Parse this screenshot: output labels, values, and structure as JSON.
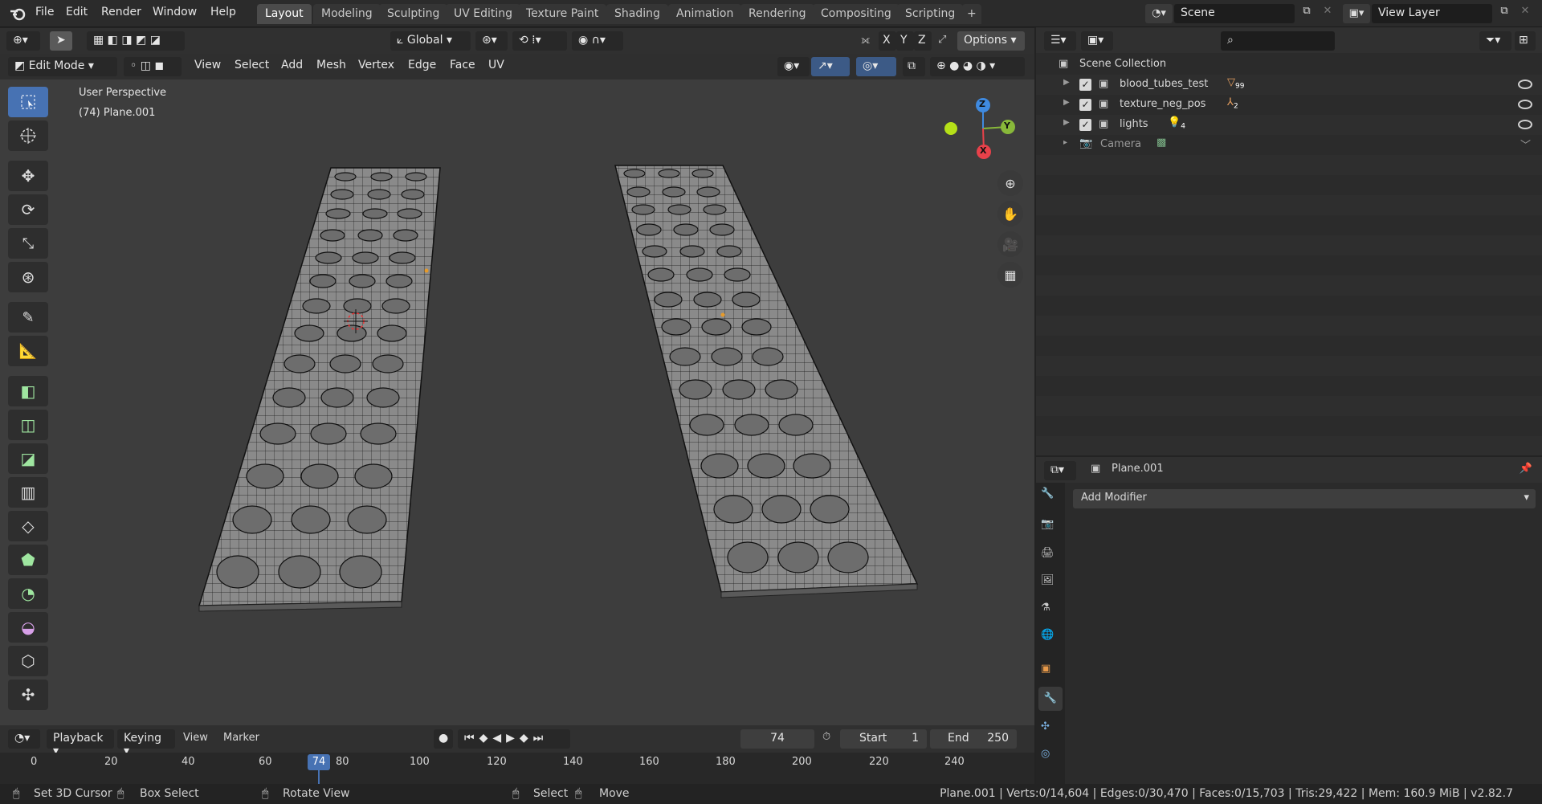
{
  "menu": [
    "File",
    "Edit",
    "Render",
    "Window",
    "Help"
  ],
  "workspaces": [
    "Layout",
    "Modeling",
    "Sculpting",
    "UV Editing",
    "Texture Paint",
    "Shading",
    "Animation",
    "Rendering",
    "Compositing",
    "Scripting"
  ],
  "active_workspace": "Layout",
  "scene_name": "Scene",
  "view_layer": "View Layer",
  "viewport": {
    "transform_orientation": "Global",
    "options_label": "Options",
    "axis_x": "X",
    "axis_y": "Y",
    "axis_z": "Z",
    "mode": "Edit Mode",
    "header_menus": [
      "View",
      "Select",
      "Add",
      "Mesh",
      "Vertex",
      "Edge",
      "Face",
      "UV"
    ],
    "overlay_title": "User Perspective",
    "overlay_object": "(74) Plane.001",
    "gizmo": {
      "x": "X",
      "y": "Y",
      "z": "Z"
    }
  },
  "outliner": {
    "root": "Scene Collection",
    "items": [
      {
        "name": "blood_tubes_test",
        "badge": "99",
        "checked": true,
        "icon": "mesh-icon"
      },
      {
        "name": "texture_neg_pos",
        "badge": "2",
        "checked": true,
        "icon": "armature-icon"
      },
      {
        "name": "lights",
        "badge": "4",
        "checked": true,
        "icon": "light-icon"
      },
      {
        "name": "Camera",
        "badge": "",
        "checked": false,
        "icon": "camera-icon"
      }
    ]
  },
  "properties": {
    "object_name": "Plane.001",
    "add_modifier": "Add Modifier"
  },
  "timeline": {
    "menus": [
      "Playback",
      "Keying",
      "View",
      "Marker"
    ],
    "current_frame": "74",
    "start_label": "Start",
    "start_value": "1",
    "end_label": "End",
    "end_value": "250",
    "ruler": [
      "0",
      "20",
      "40",
      "60",
      "80",
      "100",
      "120",
      "140",
      "160",
      "180",
      "200",
      "220",
      "240"
    ],
    "current_marker": "74"
  },
  "status": {
    "set_cursor": "Set 3D Cursor",
    "box_select": "Box Select",
    "rotate_view": "Rotate View",
    "select": "Select",
    "move": "Move",
    "stats": "Plane.001 | Verts:0/14,604 | Edges:0/30,470 | Faces:0/15,703 | Tris:29,422 | Mem: 160.9 MiB | v2.82.7"
  },
  "colors": {
    "accent": "#4772b3",
    "frame_marker": "#4772b3",
    "gizmo_x": "#e8414a",
    "gizmo_y": "#88b83a",
    "gizmo_z": "#3f8ae0"
  }
}
